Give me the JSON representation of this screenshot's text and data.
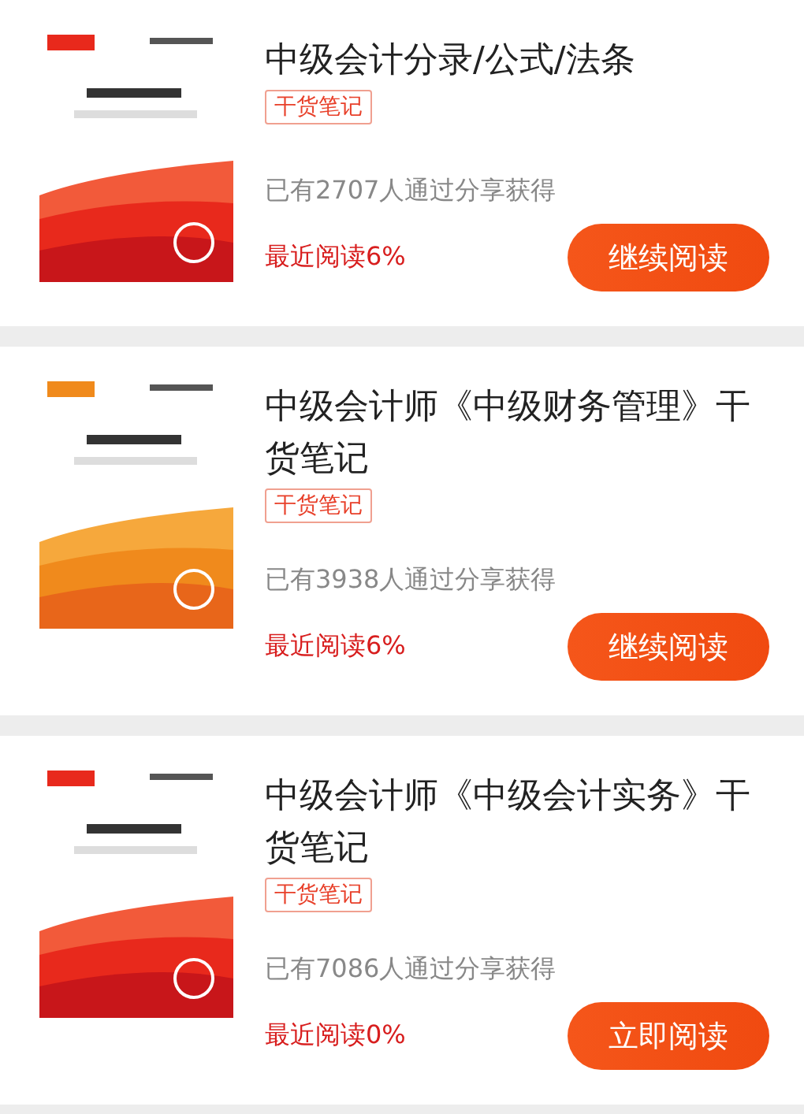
{
  "books": [
    {
      "cover": {
        "kind": "red"
      },
      "title": "中级会计分录/公式/法条",
      "tag": "干货笔记",
      "shares": "已有2707人通过分享获得",
      "progress": "最近阅读6%",
      "button": "继续阅读"
    },
    {
      "cover": {
        "kind": "orange"
      },
      "title": "中级会计师《中级财务管理》干货笔记",
      "tag": "干货笔记",
      "shares": "已有3938人通过分享获得",
      "progress": "最近阅读6%",
      "button": "继续阅读"
    },
    {
      "cover": {
        "kind": "red"
      },
      "title": "中级会计师《中级会计实务》干货笔记",
      "tag": "干货笔记",
      "shares": "已有7086人通过分享获得",
      "progress": "最近阅读0%",
      "button": "立即阅读"
    }
  ]
}
